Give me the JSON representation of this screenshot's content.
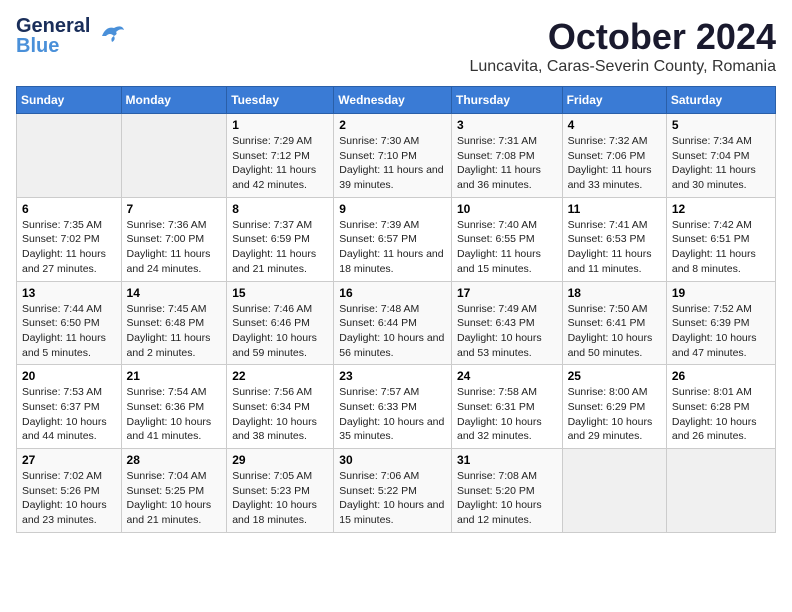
{
  "header": {
    "logo_general": "General",
    "logo_blue": "Blue",
    "month": "October 2024",
    "location": "Luncavita, Caras-Severin County, Romania"
  },
  "weekdays": [
    "Sunday",
    "Monday",
    "Tuesday",
    "Wednesday",
    "Thursday",
    "Friday",
    "Saturday"
  ],
  "weeks": [
    [
      {
        "day": "",
        "sunrise": "",
        "sunset": "",
        "daylight": ""
      },
      {
        "day": "",
        "sunrise": "",
        "sunset": "",
        "daylight": ""
      },
      {
        "day": "1",
        "sunrise": "Sunrise: 7:29 AM",
        "sunset": "Sunset: 7:12 PM",
        "daylight": "Daylight: 11 hours and 42 minutes."
      },
      {
        "day": "2",
        "sunrise": "Sunrise: 7:30 AM",
        "sunset": "Sunset: 7:10 PM",
        "daylight": "Daylight: 11 hours and 39 minutes."
      },
      {
        "day": "3",
        "sunrise": "Sunrise: 7:31 AM",
        "sunset": "Sunset: 7:08 PM",
        "daylight": "Daylight: 11 hours and 36 minutes."
      },
      {
        "day": "4",
        "sunrise": "Sunrise: 7:32 AM",
        "sunset": "Sunset: 7:06 PM",
        "daylight": "Daylight: 11 hours and 33 minutes."
      },
      {
        "day": "5",
        "sunrise": "Sunrise: 7:34 AM",
        "sunset": "Sunset: 7:04 PM",
        "daylight": "Daylight: 11 hours and 30 minutes."
      }
    ],
    [
      {
        "day": "6",
        "sunrise": "Sunrise: 7:35 AM",
        "sunset": "Sunset: 7:02 PM",
        "daylight": "Daylight: 11 hours and 27 minutes."
      },
      {
        "day": "7",
        "sunrise": "Sunrise: 7:36 AM",
        "sunset": "Sunset: 7:00 PM",
        "daylight": "Daylight: 11 hours and 24 minutes."
      },
      {
        "day": "8",
        "sunrise": "Sunrise: 7:37 AM",
        "sunset": "Sunset: 6:59 PM",
        "daylight": "Daylight: 11 hours and 21 minutes."
      },
      {
        "day": "9",
        "sunrise": "Sunrise: 7:39 AM",
        "sunset": "Sunset: 6:57 PM",
        "daylight": "Daylight: 11 hours and 18 minutes."
      },
      {
        "day": "10",
        "sunrise": "Sunrise: 7:40 AM",
        "sunset": "Sunset: 6:55 PM",
        "daylight": "Daylight: 11 hours and 15 minutes."
      },
      {
        "day": "11",
        "sunrise": "Sunrise: 7:41 AM",
        "sunset": "Sunset: 6:53 PM",
        "daylight": "Daylight: 11 hours and 11 minutes."
      },
      {
        "day": "12",
        "sunrise": "Sunrise: 7:42 AM",
        "sunset": "Sunset: 6:51 PM",
        "daylight": "Daylight: 11 hours and 8 minutes."
      }
    ],
    [
      {
        "day": "13",
        "sunrise": "Sunrise: 7:44 AM",
        "sunset": "Sunset: 6:50 PM",
        "daylight": "Daylight: 11 hours and 5 minutes."
      },
      {
        "day": "14",
        "sunrise": "Sunrise: 7:45 AM",
        "sunset": "Sunset: 6:48 PM",
        "daylight": "Daylight: 11 hours and 2 minutes."
      },
      {
        "day": "15",
        "sunrise": "Sunrise: 7:46 AM",
        "sunset": "Sunset: 6:46 PM",
        "daylight": "Daylight: 10 hours and 59 minutes."
      },
      {
        "day": "16",
        "sunrise": "Sunrise: 7:48 AM",
        "sunset": "Sunset: 6:44 PM",
        "daylight": "Daylight: 10 hours and 56 minutes."
      },
      {
        "day": "17",
        "sunrise": "Sunrise: 7:49 AM",
        "sunset": "Sunset: 6:43 PM",
        "daylight": "Daylight: 10 hours and 53 minutes."
      },
      {
        "day": "18",
        "sunrise": "Sunrise: 7:50 AM",
        "sunset": "Sunset: 6:41 PM",
        "daylight": "Daylight: 10 hours and 50 minutes."
      },
      {
        "day": "19",
        "sunrise": "Sunrise: 7:52 AM",
        "sunset": "Sunset: 6:39 PM",
        "daylight": "Daylight: 10 hours and 47 minutes."
      }
    ],
    [
      {
        "day": "20",
        "sunrise": "Sunrise: 7:53 AM",
        "sunset": "Sunset: 6:37 PM",
        "daylight": "Daylight: 10 hours and 44 minutes."
      },
      {
        "day": "21",
        "sunrise": "Sunrise: 7:54 AM",
        "sunset": "Sunset: 6:36 PM",
        "daylight": "Daylight: 10 hours and 41 minutes."
      },
      {
        "day": "22",
        "sunrise": "Sunrise: 7:56 AM",
        "sunset": "Sunset: 6:34 PM",
        "daylight": "Daylight: 10 hours and 38 minutes."
      },
      {
        "day": "23",
        "sunrise": "Sunrise: 7:57 AM",
        "sunset": "Sunset: 6:33 PM",
        "daylight": "Daylight: 10 hours and 35 minutes."
      },
      {
        "day": "24",
        "sunrise": "Sunrise: 7:58 AM",
        "sunset": "Sunset: 6:31 PM",
        "daylight": "Daylight: 10 hours and 32 minutes."
      },
      {
        "day": "25",
        "sunrise": "Sunrise: 8:00 AM",
        "sunset": "Sunset: 6:29 PM",
        "daylight": "Daylight: 10 hours and 29 minutes."
      },
      {
        "day": "26",
        "sunrise": "Sunrise: 8:01 AM",
        "sunset": "Sunset: 6:28 PM",
        "daylight": "Daylight: 10 hours and 26 minutes."
      }
    ],
    [
      {
        "day": "27",
        "sunrise": "Sunrise: 7:02 AM",
        "sunset": "Sunset: 5:26 PM",
        "daylight": "Daylight: 10 hours and 23 minutes."
      },
      {
        "day": "28",
        "sunrise": "Sunrise: 7:04 AM",
        "sunset": "Sunset: 5:25 PM",
        "daylight": "Daylight: 10 hours and 21 minutes."
      },
      {
        "day": "29",
        "sunrise": "Sunrise: 7:05 AM",
        "sunset": "Sunset: 5:23 PM",
        "daylight": "Daylight: 10 hours and 18 minutes."
      },
      {
        "day": "30",
        "sunrise": "Sunrise: 7:06 AM",
        "sunset": "Sunset: 5:22 PM",
        "daylight": "Daylight: 10 hours and 15 minutes."
      },
      {
        "day": "31",
        "sunrise": "Sunrise: 7:08 AM",
        "sunset": "Sunset: 5:20 PM",
        "daylight": "Daylight: 10 hours and 12 minutes."
      },
      {
        "day": "",
        "sunrise": "",
        "sunset": "",
        "daylight": ""
      },
      {
        "day": "",
        "sunrise": "",
        "sunset": "",
        "daylight": ""
      }
    ]
  ]
}
